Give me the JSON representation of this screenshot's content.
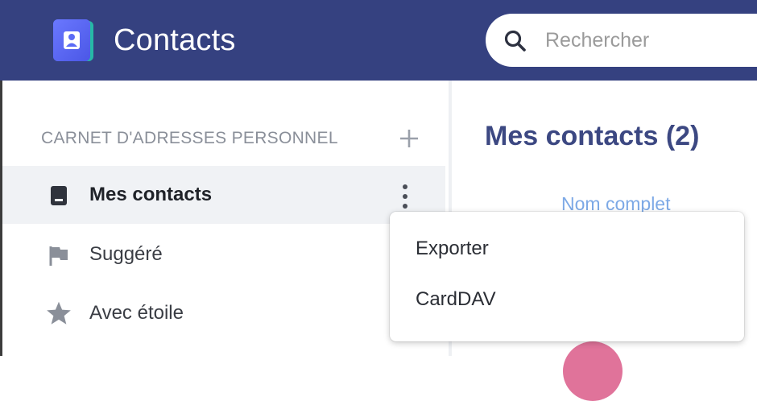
{
  "header": {
    "app_title": "Contacts",
    "logo_icon": "contacts-app-icon",
    "bg_color": "#354180",
    "search": {
      "placeholder": "Rechercher",
      "value": ""
    }
  },
  "sidebar": {
    "section_title": "CARNET D'ADRESSES PERSONNEL",
    "items": [
      {
        "label": "Mes contacts",
        "icon": "address-book-icon",
        "active": true
      },
      {
        "label": "Suggéré",
        "icon": "flag-icon",
        "active": false
      },
      {
        "label": "Avec étoile",
        "icon": "star-icon",
        "active": false
      }
    ]
  },
  "main": {
    "title": "Mes contacts (2)",
    "column_header": "Nom complet"
  },
  "context_menu": {
    "items": [
      {
        "label": "Exporter"
      },
      {
        "label": "CardDAV"
      }
    ]
  }
}
